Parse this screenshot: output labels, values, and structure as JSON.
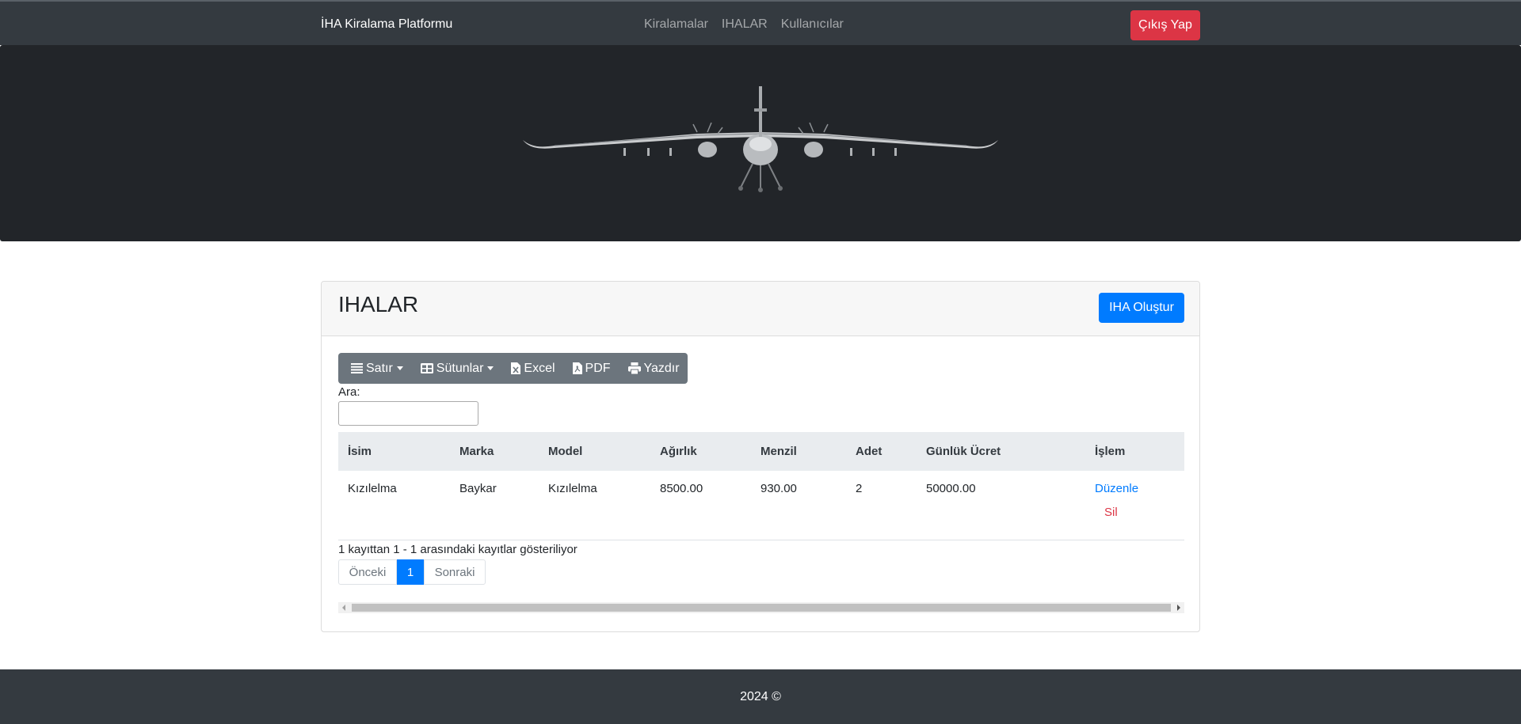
{
  "navbar": {
    "brand": "İHA Kiralama Platformu",
    "links": [
      "Kiralamalar",
      "IHALAR",
      "Kullanıcılar"
    ],
    "logout_label": "Çıkış Yap"
  },
  "card": {
    "title": "IHALAR",
    "create_label": "IHA Oluştur"
  },
  "toolbar": {
    "rows_label": "Satır",
    "columns_label": "Sütunlar",
    "excel_label": "Excel",
    "pdf_label": "PDF",
    "print_label": "Yazdır"
  },
  "search": {
    "label": "Ara:",
    "value": ""
  },
  "table": {
    "headers": [
      "İsim",
      "Marka",
      "Model",
      "Ağırlık",
      "Menzil",
      "Adet",
      "Günlük Ücret",
      "İşlem"
    ],
    "rows": [
      {
        "isim": "Kızılelma",
        "marka": "Baykar",
        "model": "Kızılelma",
        "agirlik": "8500.00",
        "menzil": "930.00",
        "adet": "2",
        "ucret": "50000.00",
        "edit": "Düzenle",
        "delete": "Sil"
      }
    ]
  },
  "info_text": "1 kayıttan 1 - 1 arasındaki kayıtlar gösteriliyor",
  "pagination": {
    "prev": "Önceki",
    "current": "1",
    "next": "Sonraki"
  },
  "footer": {
    "text": "2024 ©"
  },
  "colors": {
    "navbar": "#343a40",
    "primary": "#007bff",
    "danger": "#dc3545",
    "toolbar": "#6c757d",
    "hero": "#222529"
  },
  "icons": [
    "list-icon",
    "table-icon",
    "file-excel-icon",
    "file-pdf-icon",
    "print-icon",
    "drone-image"
  ]
}
